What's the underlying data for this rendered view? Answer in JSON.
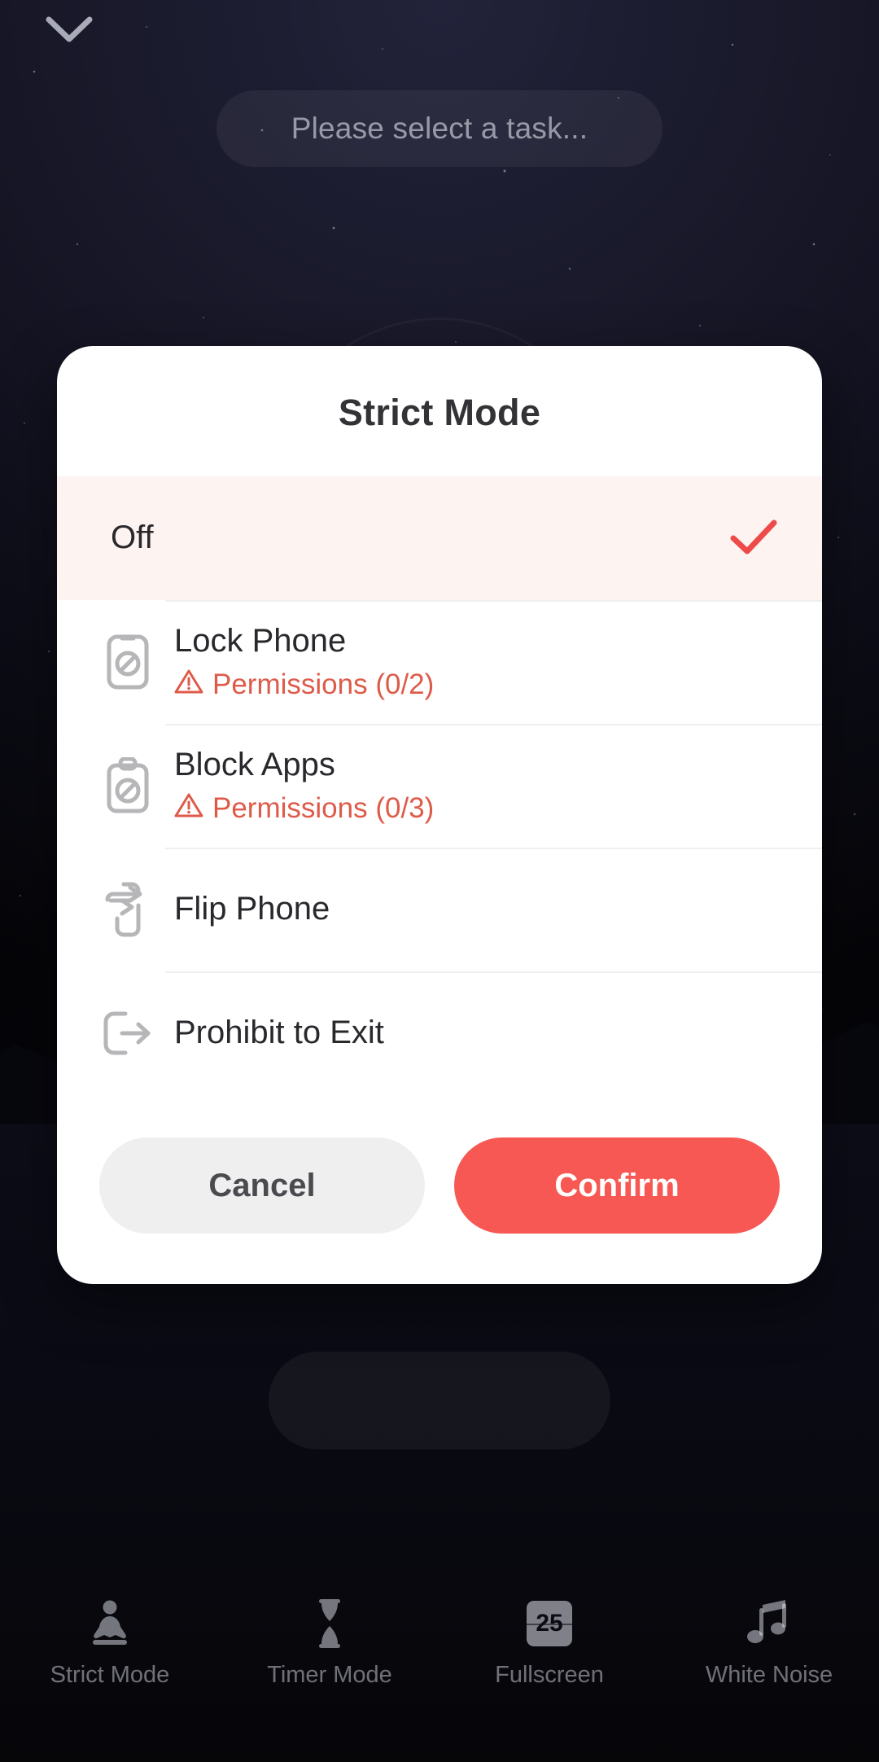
{
  "background": {
    "theme": "night-sky-lake",
    "collapse_icon": "chevron-down-icon"
  },
  "task_selector": {
    "placeholder": "Please select a task...",
    "value": ""
  },
  "dialog": {
    "title": "Strict Mode",
    "options": [
      {
        "label": "Off",
        "icon": "none",
        "selected": true,
        "check_icon": "check-icon",
        "permission": null
      },
      {
        "label": "Lock Phone",
        "icon": "phone-blocked-icon",
        "selected": false,
        "permission": {
          "warning_icon": "warning-triangle-icon",
          "text": "Permissions (0/2)"
        }
      },
      {
        "label": "Block Apps",
        "icon": "clipboard-blocked-icon",
        "selected": false,
        "permission": {
          "warning_icon": "warning-triangle-icon",
          "text": "Permissions (0/3)"
        }
      },
      {
        "label": "Flip Phone",
        "icon": "phone-flip-icon",
        "selected": false,
        "permission": null
      },
      {
        "label": "Prohibit to Exit",
        "icon": "exit-blocked-icon",
        "selected": false,
        "permission": null
      }
    ],
    "cancel_label": "Cancel",
    "confirm_label": "Confirm"
  },
  "bottom_nav": {
    "items": [
      {
        "label": "Strict Mode",
        "icon": "meditation-icon"
      },
      {
        "label": "Timer Mode",
        "icon": "hourglass-icon"
      },
      {
        "label": "Fullscreen",
        "icon": "flip-clock-25-icon",
        "badge": "25"
      },
      {
        "label": "White Noise",
        "icon": "music-note-icon"
      }
    ]
  },
  "colors": {
    "accent_red": "#f75853",
    "warning_red": "#de5b4a",
    "selected_row_bg": "#fdf3f1",
    "cancel_bg": "#efefef",
    "dialog_bg": "#ffffff",
    "title_text": "#333337"
  }
}
